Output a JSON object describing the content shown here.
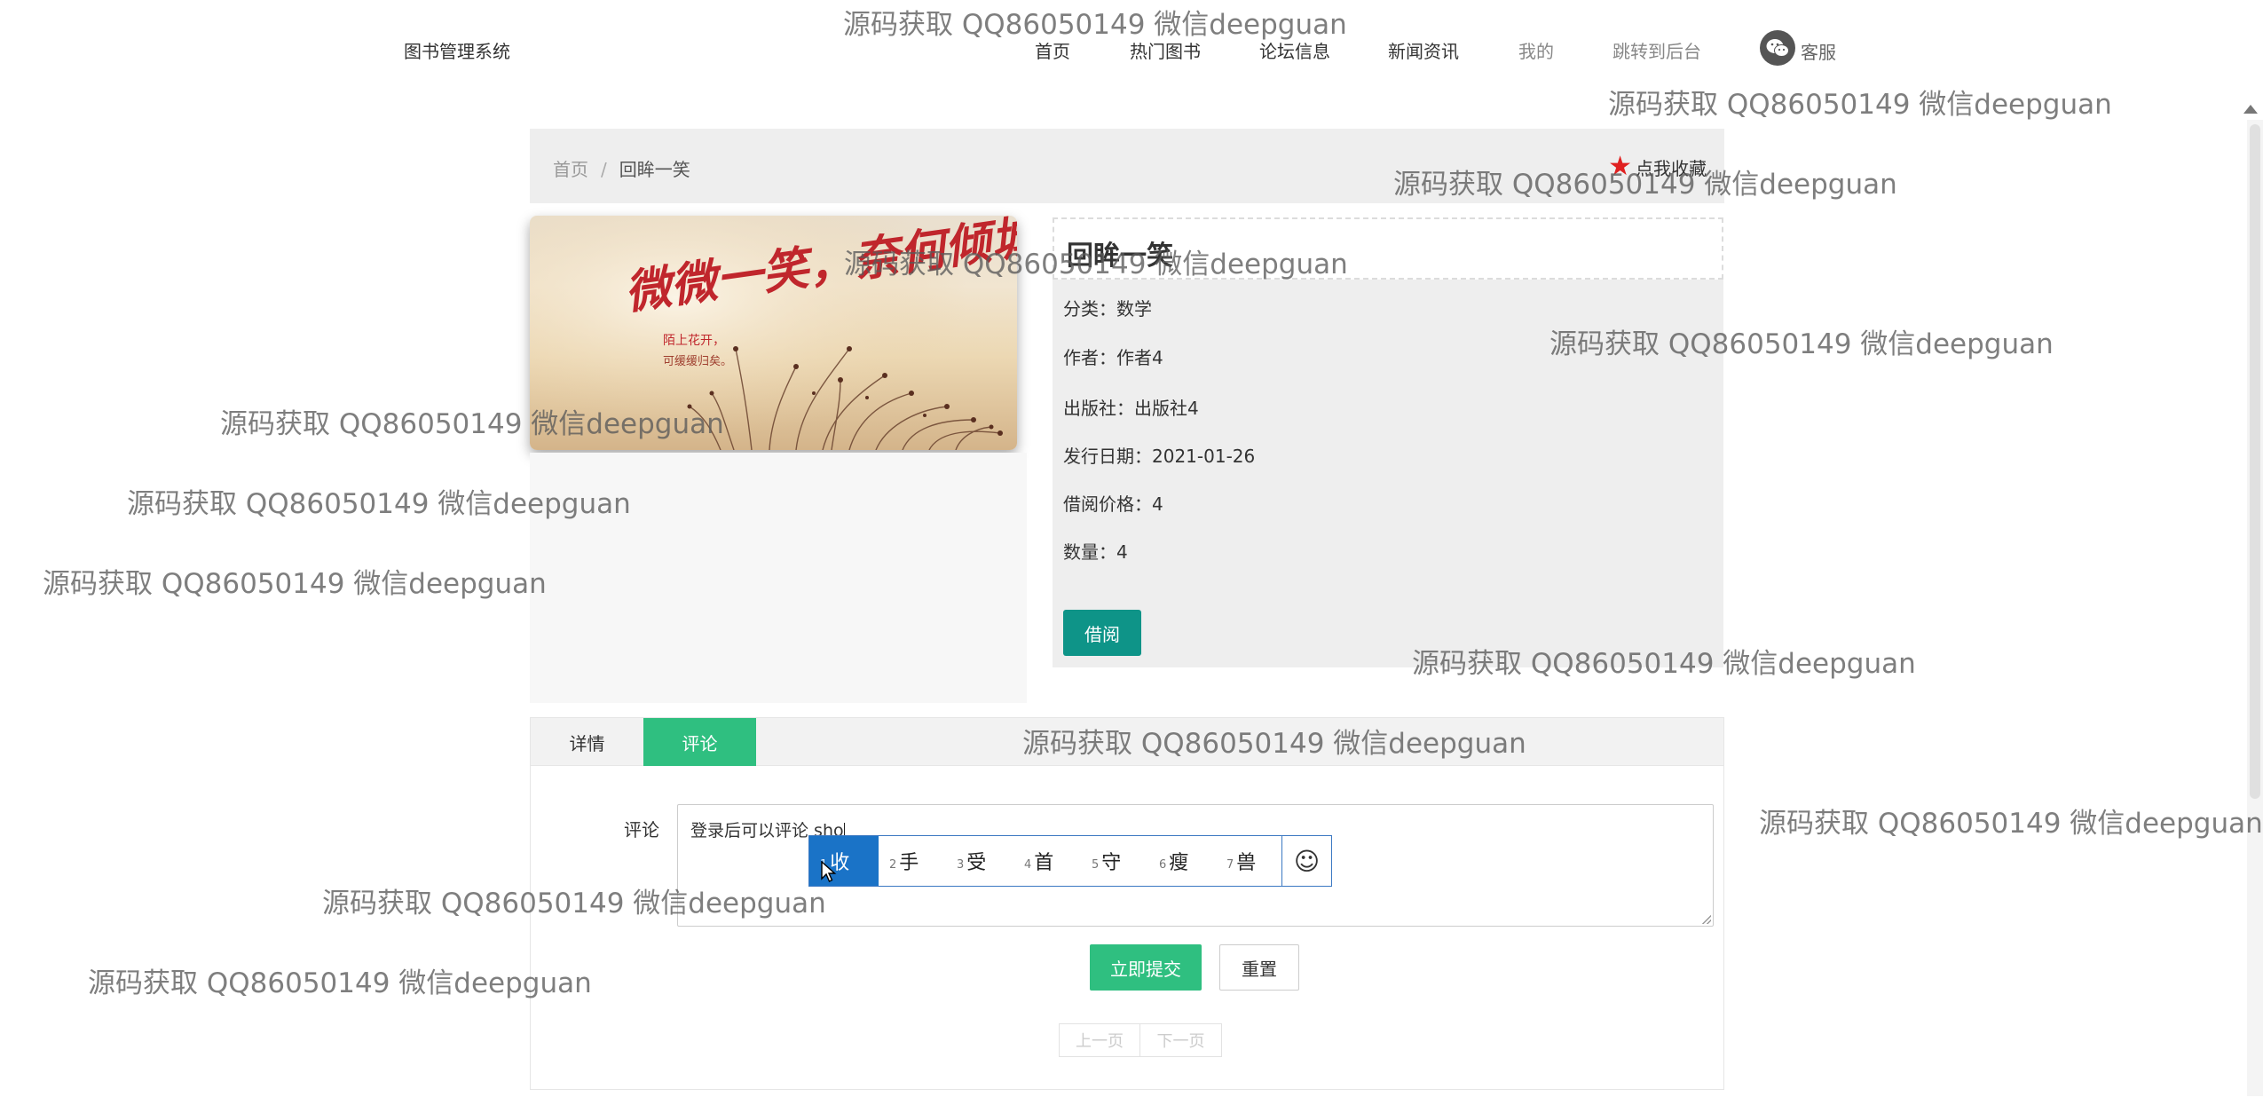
{
  "header": {
    "brand": "图书管理系统",
    "nav": [
      {
        "label": "首页",
        "muted": false
      },
      {
        "label": "热门图书",
        "muted": false
      },
      {
        "label": "论坛信息",
        "muted": false
      },
      {
        "label": "新闻资讯",
        "muted": false
      },
      {
        "label": "我的",
        "muted": true
      },
      {
        "label": "跳转到后台",
        "muted": true
      }
    ],
    "service_label": "客服"
  },
  "breadcrumb": {
    "home": "首页",
    "separator": "/",
    "current": "回眸一笑",
    "favorite": "点我收藏"
  },
  "book": {
    "title": "回眸一笑",
    "fields": [
      {
        "label": "分类：",
        "value": "数学"
      },
      {
        "label": "作者：",
        "value": "作者4"
      },
      {
        "label": "出版社：",
        "value": "出版社4"
      },
      {
        "label": "发行日期：",
        "value": "2021-01-26"
      },
      {
        "label": "借阅价格：",
        "value": "4"
      },
      {
        "label": "数量：",
        "value": "4"
      }
    ],
    "borrow_label": "借阅",
    "image_text": {
      "big": "微微一笑，奈何倾城",
      "small1": "陌上花开，",
      "small2": "可缓缓归矣。"
    }
  },
  "tabs": [
    {
      "label": "详情",
      "active": false
    },
    {
      "label": "评论",
      "active": true
    }
  ],
  "comment": {
    "label": "评论",
    "value": "登录后可以评论 sho"
  },
  "ime": {
    "candidates": [
      {
        "n": "1",
        "text": "收"
      },
      {
        "n": "2",
        "text": "手"
      },
      {
        "n": "3",
        "text": "受"
      },
      {
        "n": "4",
        "text": "首"
      },
      {
        "n": "5",
        "text": "守"
      },
      {
        "n": "6",
        "text": "瘦"
      },
      {
        "n": "7",
        "text": "兽"
      }
    ],
    "emoji": "☺"
  },
  "actions": {
    "submit": "立即提交",
    "reset": "重置",
    "prev": "上一页",
    "next": "下一页"
  },
  "watermark": "源码获取 QQ86050149 微信deepguan",
  "colors": {
    "accent_green": "#2fbf80",
    "borrow_teal": "#0e9488",
    "favorite_star": "#e02020",
    "ime_selected": "#1a73c7"
  }
}
